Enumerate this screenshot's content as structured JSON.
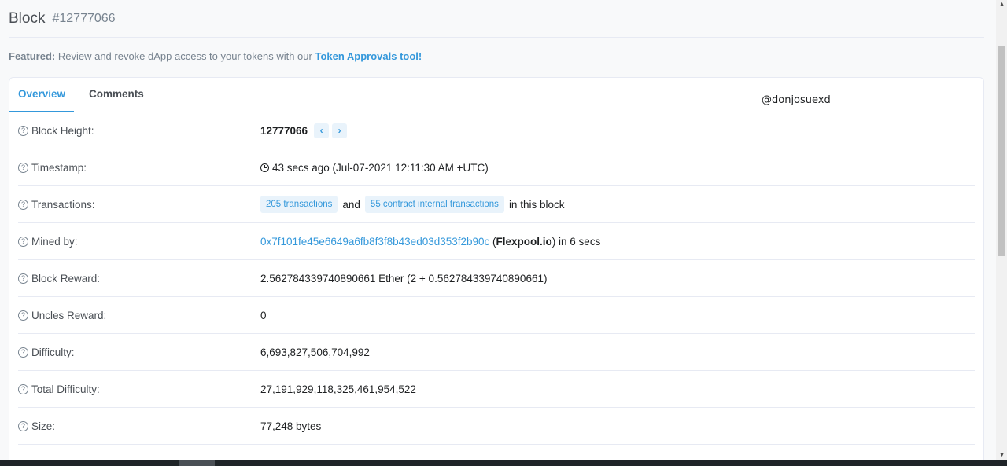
{
  "header": {
    "title": "Block",
    "block_number": "#12777066"
  },
  "featured": {
    "prefix": "Featured:",
    "text": " Review and revoke dApp access to your tokens with our ",
    "link": "Token Approvals tool!"
  },
  "tabs": [
    {
      "label": "Overview",
      "active": true
    },
    {
      "label": "Comments",
      "active": false
    }
  ],
  "watermark": "@donjosuexd",
  "rows": {
    "block_height": {
      "label": "Block Height:",
      "value": "12777066",
      "prev_icon": "chevron-left-icon",
      "next_icon": "chevron-right-icon"
    },
    "timestamp": {
      "label": "Timestamp:",
      "value": "43 secs ago (Jul-07-2021 12:11:30 AM +UTC)"
    },
    "transactions": {
      "label": "Transactions:",
      "tx_pill": "205 transactions",
      "and": "and",
      "internal_pill": "55 contract internal transactions",
      "suffix": "in this block"
    },
    "mined_by": {
      "label": "Mined by:",
      "address": "0x7f101fe45e6649a6fb8f3f8b43ed03d353f2b90c",
      "open": " (",
      "pool": "Flexpool.io",
      "suffix": ") in 6 secs"
    },
    "block_reward": {
      "label": "Block Reward:",
      "value": "2.562784339740890661 Ether (2 + 0.562784339740890661)"
    },
    "uncles_reward": {
      "label": "Uncles Reward:",
      "value": "0"
    },
    "difficulty": {
      "label": "Difficulty:",
      "value": "6,693,827,506,704,992"
    },
    "total_difficulty": {
      "label": "Total Difficulty:",
      "value": "27,191,929,118,325,461,954,522"
    },
    "size": {
      "label": "Size:",
      "value": "77,248 bytes"
    }
  },
  "colors": {
    "accent": "#3498db",
    "pill_bg": "#e9f3fb",
    "border": "#e7eaf3"
  }
}
